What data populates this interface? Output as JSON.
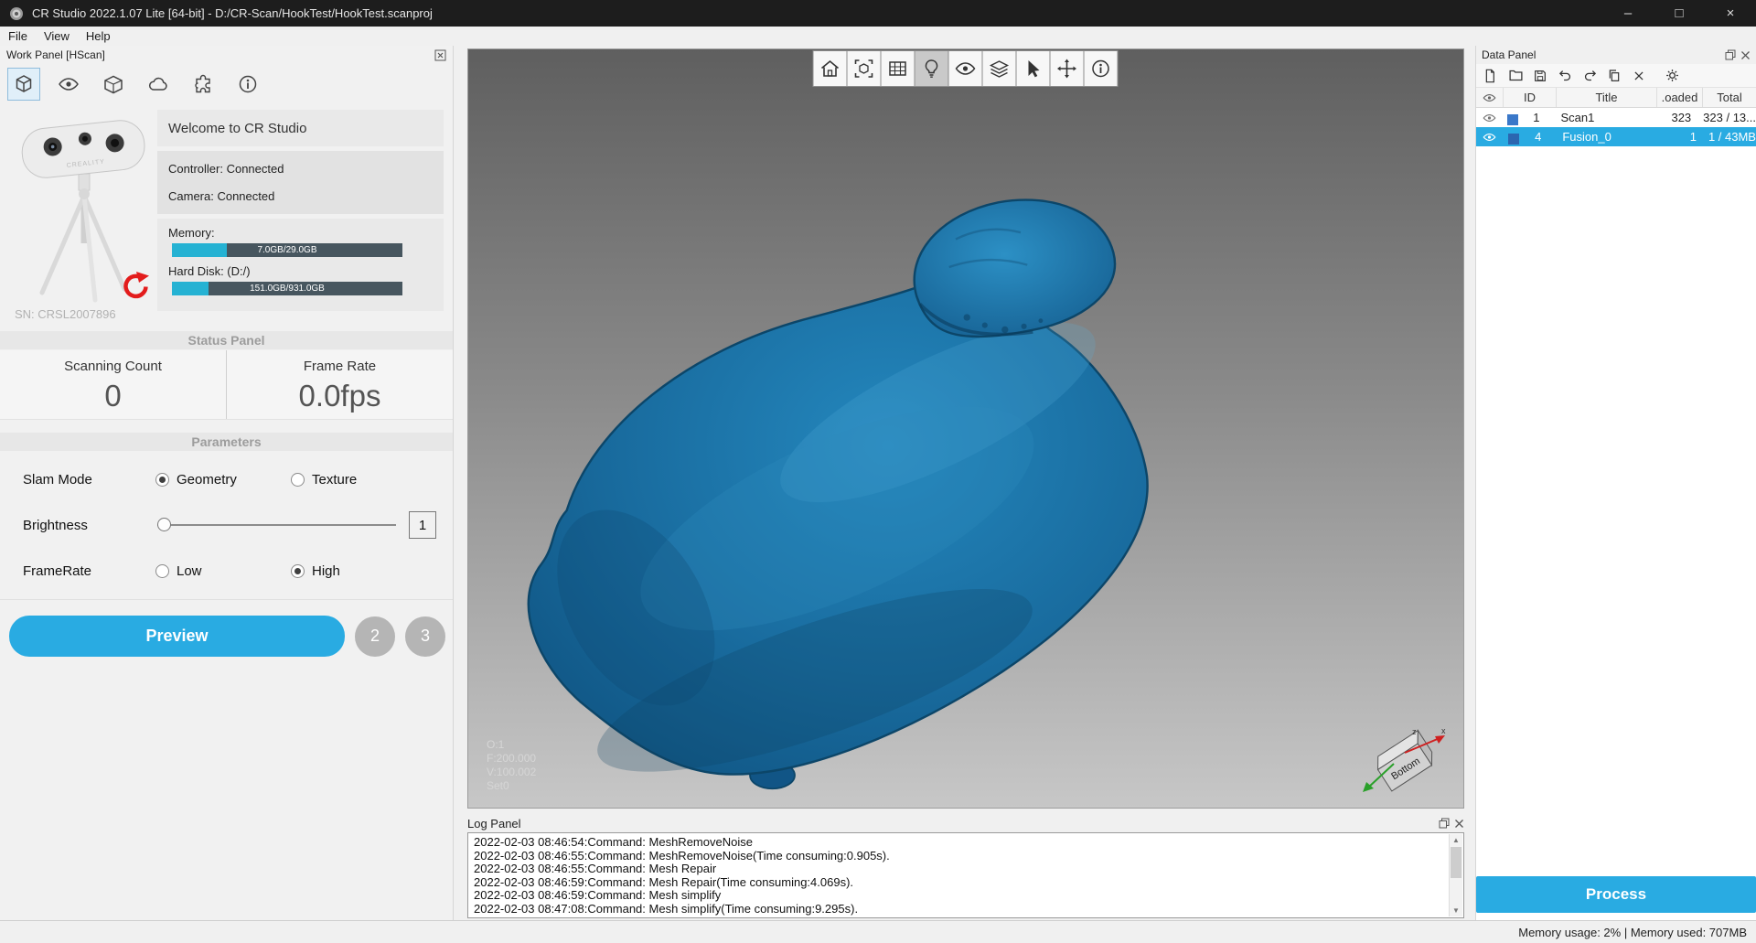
{
  "window": {
    "title": "CR Studio 2022.1.07 Lite [64-bit] - D:/CR-Scan/HookTest/HookTest.scanproj",
    "minimize": "–",
    "maximize": "□",
    "close": "×"
  },
  "menu": {
    "file": "File",
    "view": "View",
    "help": "Help"
  },
  "work_panel": {
    "title": "Work Panel [HScan]",
    "welcome": "Welcome to CR Studio",
    "controller": "Controller: Connected",
    "camera": "Camera: Connected",
    "memory_label": "Memory:",
    "memory_value": "7.0GB/29.0GB",
    "memory_percent": 24,
    "disk_label": "Hard Disk: (D:/)",
    "disk_value": "151.0GB/931.0GB",
    "disk_percent": 16,
    "device_sn": "SN: CRSL2007896",
    "device_brand": "CREALITY",
    "status_panel_title": "Status Panel",
    "scanning_count_label": "Scanning Count",
    "scanning_count_value": "0",
    "frame_rate_label": "Frame Rate",
    "frame_rate_value": "0.0fps",
    "parameters_title": "Parameters",
    "slam_mode_label": "Slam Mode",
    "slam_geometry": "Geometry",
    "slam_texture": "Texture",
    "brightness_label": "Brightness",
    "brightness_value": "1",
    "framerate_label": "FrameRate",
    "framerate_low": "Low",
    "framerate_high": "High",
    "preview_button": "Preview",
    "step_2": "2",
    "step_3": "3"
  },
  "viewport": {
    "overlay_o": "O:1",
    "overlay_f": "F:200.000",
    "overlay_v": "V:100.002",
    "overlay_set": "Set0",
    "gizmo_label": "Bottom",
    "gizmo_axis_x": "x",
    "gizmo_axis_z": "z"
  },
  "log_panel": {
    "title": "Log Panel",
    "scroll_up": "▲",
    "scroll_down": "▼",
    "entries": [
      "2022-02-03 08:46:54:Command: MeshRemoveNoise",
      "2022-02-03 08:46:55:Command: MeshRemoveNoise(Time consuming:0.905s).",
      "2022-02-03 08:46:55:Command: Mesh Repair",
      "2022-02-03 08:46:59:Command: Mesh Repair(Time consuming:4.069s).",
      "2022-02-03 08:46:59:Command: Mesh simplify",
      "2022-02-03 08:47:08:Command: Mesh simplify(Time consuming:9.295s)."
    ]
  },
  "data_panel": {
    "title": "Data Panel",
    "col_id": "ID",
    "col_title": "Title",
    "col_loaded": ".oaded",
    "col_total": "Total",
    "rows": [
      {
        "id": "1",
        "title": "Scan1",
        "loaded": "323",
        "total": "323 / 13..."
      },
      {
        "id": "4",
        "title": "Fusion_0",
        "loaded": "1",
        "total": "1 / 43MB"
      }
    ],
    "process_button": "Process"
  },
  "status_bar": {
    "text": "Memory usage: 2% | Memory used: 707MB"
  }
}
